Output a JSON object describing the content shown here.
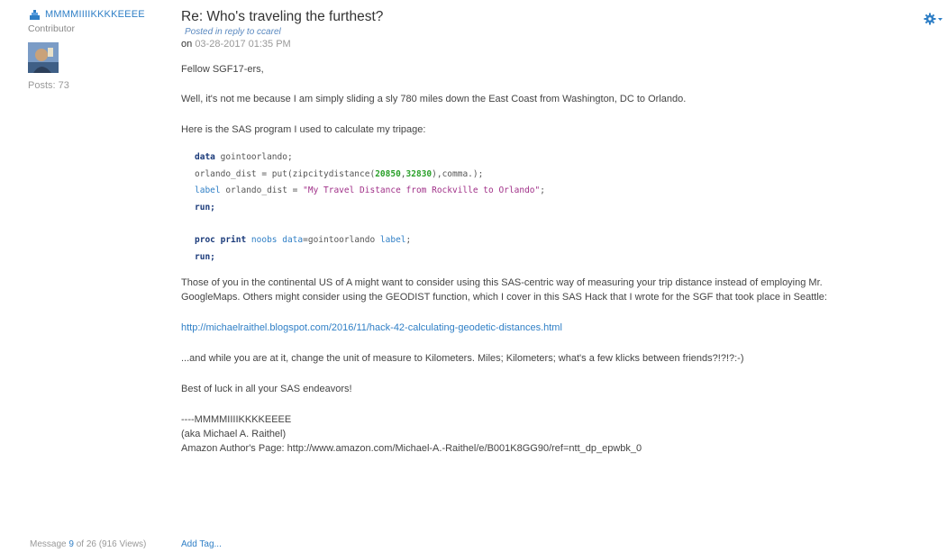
{
  "author": {
    "name": "MMMMIIIIKKKKEEEE",
    "rank": "Contributor",
    "posts_label": "Posts:",
    "posts_count": "73"
  },
  "post": {
    "title": "Re: Who's traveling the furthest?",
    "reply_prefix": "Posted in reply to",
    "reply_user": "ccarel",
    "date_prefix": "on",
    "date": "03-28-2017 01:35 PM",
    "greeting": "Fellow SGF17-ers,",
    "para1": "Well, it's not me because I am simply sliding a sly 780 miles down the East Coast from Washington, DC to Orlando.",
    "para2": "Here is the SAS program I used to calculate my tripage:",
    "code": {
      "l1_kw": "data",
      "l1_rest": " gointoorlando;",
      "l2_a": "orlando_dist = put(zipcitydistance(",
      "l2_n1": "20850",
      "l2_c": ",",
      "l2_n2": "32830",
      "l2_b": "),comma.);",
      "l3_kw": "label",
      "l3_a": " orlando_dist = ",
      "l3_str": "\"My Travel Distance from Rockville to Orlando\"",
      "l3_end": ";",
      "l4": "run;",
      "l5_kw": "proc print",
      "l5_opt1": " noobs data",
      "l5_eq": "=gointoorlando ",
      "l5_opt2": "label",
      "l5_end": ";",
      "l6": "run;"
    },
    "para3_line1": "Those of you in the continental US of A might want to consider using this SAS-centric way of measuring your trip distance instead of employing Mr.",
    "para3_line2": "GoogleMaps.  Others might consider using the GEODIST function, which I cover in this SAS Hack that I wrote for the SGF that took place in Seattle:",
    "link": "http://michaelraithel.blogspot.com/2016/11/hack-42-calculating-geodetic-distances.html",
    "para4": "...and while you are at it, change the unit of measure to Kilometers.  Miles; Kilometers; what's a few klicks between friends?!?!?:-)",
    "para5": "Best of luck in all your SAS endeavors!",
    "sig1": "----MMMMIIIIKKKKEEEE",
    "sig2": "(aka Michael A. Raithel)",
    "sig3": "Amazon Author's Page: http://www.amazon.com/Michael-A.-Raithel/e/B001K8GG90/ref=ntt_dp_epwbk_0"
  },
  "footer": {
    "message_label": "Message",
    "message_num": "9",
    "of_total": "of 26 (916 Views)",
    "add_tag": "Add Tag..."
  },
  "colors": {
    "link": "#2f7fc6",
    "gear": "#2f7fc6"
  },
  "icons": [
    "rank-icon",
    "gear-icon"
  ]
}
